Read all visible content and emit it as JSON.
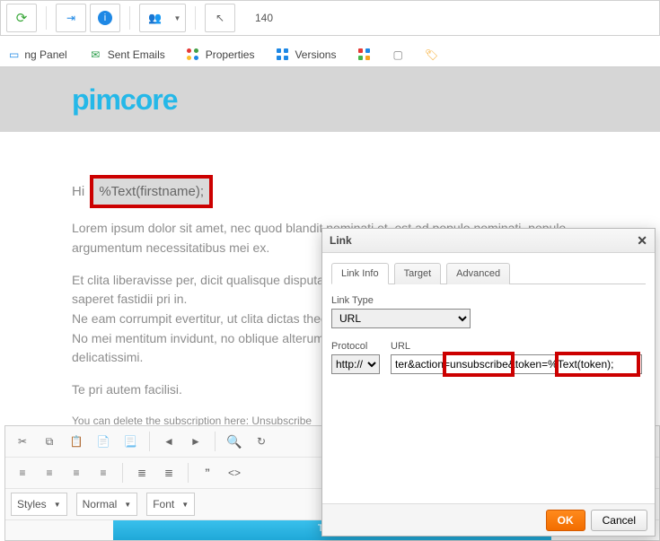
{
  "toolbar": {
    "zoom_value": "140"
  },
  "tabs": {
    "panel": "ng Panel",
    "sent_emails": "Sent Emails",
    "properties": "Properties",
    "versions": "Versions"
  },
  "logo_text": "pimcore",
  "content": {
    "greeting_prefix": "Hi ",
    "greeting_placeholder": "%Text(firstname);",
    "para1": "Lorem ipsum dolor sit amet, nec quod blandit nominati et, est ad populo nominati, populo argumentum necessitatibus mei ex.",
    "para2a": "Et clita liberavisse per, dicit qualisque disputationi ut his, affert discere vis ei. Cu labitur saperet fastidii pri in.",
    "para2b": "Ne eam corrumpit evertitur, ut clita dictas theophrastus sed.",
    "para2c": "No mei mentitum invidunt, no oblique alterum vis. Sumo invenire eu per, vivendo sapientem delicatissimi.",
    "para3": "Te pri autem facilisi.",
    "unsub_text": "You can delete the subscription here: ",
    "unsub_link": "Unsubscribe"
  },
  "editor": {
    "styles": "Styles",
    "format": "Normal",
    "font": "Font",
    "footer_tab": "Twitter"
  },
  "dialog": {
    "title": "Link",
    "tab_linkinfo": "Link Info",
    "tab_target": "Target",
    "tab_advanced": "Advanced",
    "linktype_label": "Link Type",
    "linktype_value": "URL",
    "protocol_label": "Protocol",
    "protocol_value": "http://",
    "url_label": "URL",
    "url_value": "ter&action=unsubscribe&token=%Text(token);",
    "ok": "OK",
    "cancel": "Cancel"
  }
}
